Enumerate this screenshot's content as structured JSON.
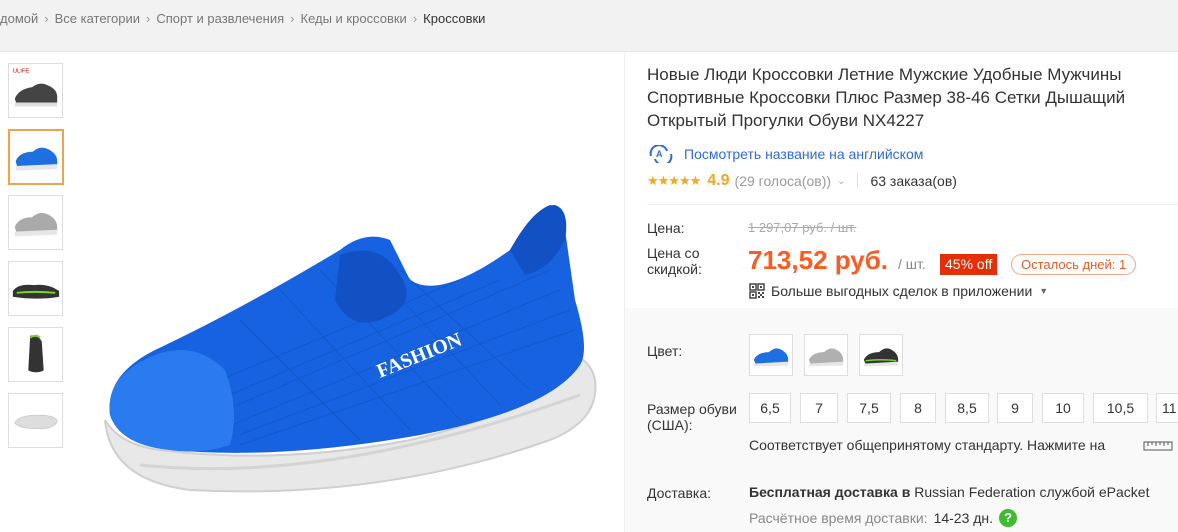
{
  "breadcrumb": [
    {
      "label": "домой"
    },
    {
      "label": "Все категории"
    },
    {
      "label": "Спорт и развлечения"
    },
    {
      "label": "Кеды и кроссовки"
    },
    {
      "label": "Кроссовки"
    }
  ],
  "product": {
    "title": "Новые Люди Кроссовки Летние Мужские Удобные Мужчины Спортивные Кроссовки Плюс Размер 38-46 Сетки Дышащий Открытый Прогулки Обуви NX4227",
    "translate_link": "Посмотреть название на английском",
    "main_image_text": "FASHION"
  },
  "rating": {
    "stars": "★★★★★",
    "value": "4.9",
    "votes": "(29 голоса(ов))",
    "orders": "63 заказа(ов)"
  },
  "price": {
    "label": "Цена:",
    "old": "1 297,07 руб. / шт.",
    "discount_label": "Цена со скидкой:",
    "current": "713,52 руб.",
    "unit": "/ шт.",
    "discount_badge": "45% off",
    "days_left": "Осталось дней: 1",
    "app_deals": "Больше выгодных сделок в приложении"
  },
  "options": {
    "color_label": "Цвет:",
    "colors": [
      "blue",
      "gray",
      "black"
    ],
    "size_label": "Размер обуви (США):",
    "sizes": [
      "6,5",
      "7",
      "7,5",
      "8",
      "8,5",
      "9",
      "10",
      "10,5",
      "11"
    ],
    "size_note": "Соответствует общепринятому стандарту. Нажмите на"
  },
  "delivery": {
    "label": "Доставка:",
    "free": "Бесплатная доставка",
    "in": "в",
    "destination": "Russian Federation службой ePacket",
    "time_label": "Расчётное время доставки:",
    "time_value": "14-23 дн.",
    "help_icon": "?"
  },
  "colors": {
    "accent": "#ff5a1f",
    "badge": "#e62e04",
    "link": "#2f6bd8",
    "star": "#f5a623",
    "active_thumb": "#f0a24c"
  }
}
